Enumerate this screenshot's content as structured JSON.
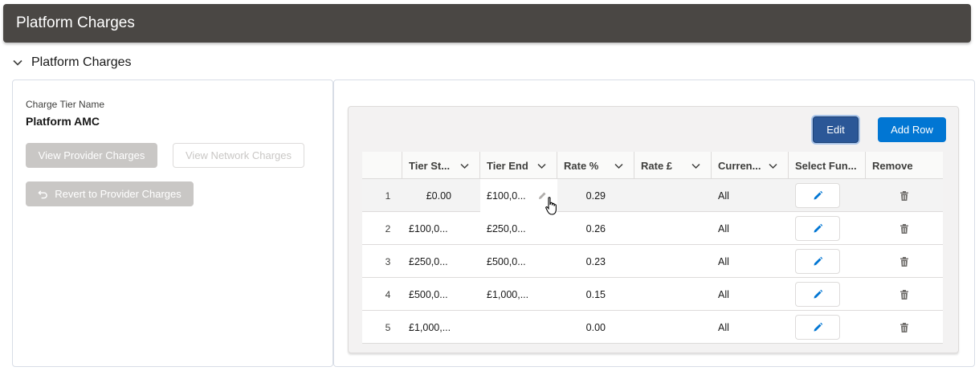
{
  "header": {
    "title": "Platform Charges"
  },
  "section": {
    "label": "Platform Charges"
  },
  "left_panel": {
    "field_label": "Charge Tier Name",
    "field_value": "Platform AMC",
    "view_provider_label": "View Provider Charges",
    "view_network_label": "View Network Charges",
    "revert_label": "Revert to Provider Charges"
  },
  "toolbar": {
    "edit_label": "Edit",
    "add_row_label": "Add Row"
  },
  "table": {
    "columns": [
      "Tier St...",
      "Tier End",
      "Rate %",
      "Rate £",
      "Curren...",
      "Select Fun...",
      "Remove"
    ],
    "rows": [
      {
        "num": "1",
        "tier_start": "£0.00",
        "tier_end": "£100,0...",
        "rate_pct": "0.29",
        "rate_gbp": "",
        "currency": "All"
      },
      {
        "num": "2",
        "tier_start": "£100,0...",
        "tier_end": "£250,0...",
        "rate_pct": "0.26",
        "rate_gbp": "",
        "currency": "All"
      },
      {
        "num": "3",
        "tier_start": "£250,0...",
        "tier_end": "£500,0...",
        "rate_pct": "0.23",
        "rate_gbp": "",
        "currency": "All"
      },
      {
        "num": "4",
        "tier_start": "£500,0...",
        "tier_end": "£1,000,...",
        "rate_pct": "0.15",
        "rate_gbp": "",
        "currency": "All"
      },
      {
        "num": "5",
        "tier_start": "£1,000,...",
        "tier_end": "",
        "rate_pct": "0.00",
        "rate_gbp": "",
        "currency": "All"
      }
    ]
  },
  "colors": {
    "header_bg": "#4a4744",
    "brand_blue": "#0176d3",
    "edit_blue": "#2b5797",
    "disabled_gray": "#c9c7c5"
  },
  "icons": {
    "section_toggle": "chevron-down-icon",
    "revert": "undo-icon",
    "column_menu": "chevron-down-icon",
    "select_funds": "pencil-icon",
    "remove": "trash-icon"
  }
}
